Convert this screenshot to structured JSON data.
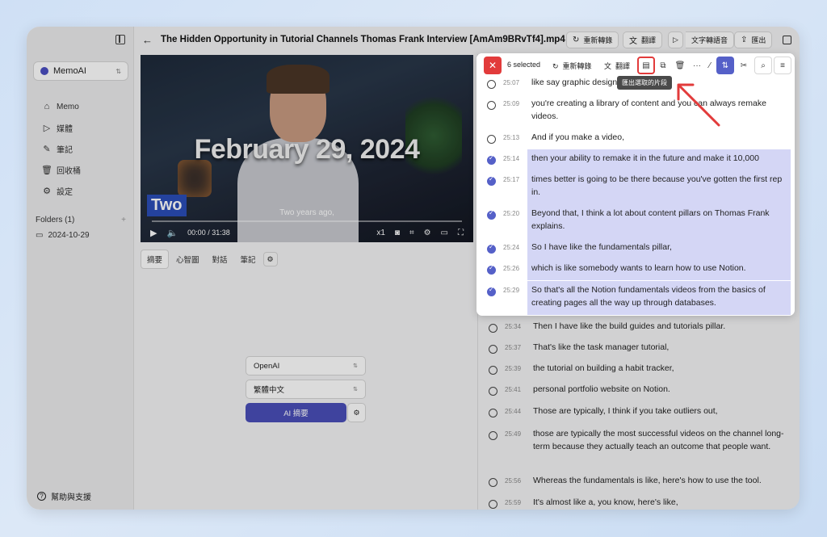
{
  "sidebar": {
    "workspace": "MemoAI",
    "nav": [
      {
        "icon": "home-icon",
        "glyph": "⌂",
        "label": "Memo"
      },
      {
        "icon": "media-icon",
        "glyph": "▷",
        "label": "媒體"
      },
      {
        "icon": "pen-icon",
        "glyph": "✎",
        "label": "筆記"
      },
      {
        "icon": "trash-icon",
        "glyph": "🗑",
        "label": "回收桶"
      },
      {
        "icon": "gear-icon",
        "glyph": "⚙",
        "label": "設定"
      }
    ],
    "folders_title": "Folders (1)",
    "folder_add": "+",
    "folders": [
      "2024-10-29"
    ],
    "help": "幫助與支援"
  },
  "topbar": {
    "title": "The Hidden Opportunity in Tutorial Channels Thomas Frank Interview [AmAm9BRvTf4].mp4",
    "buttons": {
      "retranscribe": "重新轉錄",
      "translate": "翻譯",
      "tts": "文字轉語音",
      "export": "匯出"
    }
  },
  "video": {
    "headline": "February 29, 2024",
    "tag": "Two",
    "caption": "Two years ago,",
    "time": "00:00 / 31:38",
    "speed": "x1",
    "progress": 0.0
  },
  "tabs": [
    "摘要",
    "心智圖",
    "對話",
    "筆記"
  ],
  "summary": {
    "model": "OpenAI",
    "language": "繁體中文",
    "button": "AI 摘要"
  },
  "selection": {
    "count": "6 selected",
    "retranscribe": "重新轉錄",
    "translate": "翻譯",
    "tooltip": "匯出選取的片段",
    "more": "···"
  },
  "transcript": [
    {
      "time": "25:07",
      "text": "like say graphic design or",
      "selected": false
    },
    {
      "time": "25:09",
      "text": "you're creating a library of content and you can always remake videos.",
      "selected": false
    },
    {
      "time": "25:13",
      "text": "And if you make a video,",
      "selected": false
    },
    {
      "time": "25:14",
      "text": "then your ability to remake it in the future and make it 10,000",
      "selected": true
    },
    {
      "time": "25:17",
      "text": "times better is going to be there because you've gotten the first rep in.",
      "selected": true
    },
    {
      "time": "25:20",
      "text": "Beyond that, I think a lot about content pillars on Thomas Frank explains.",
      "selected": true
    },
    {
      "time": "25:24",
      "text": "So I have like the fundamentals pillar,",
      "selected": true
    },
    {
      "time": "25:26",
      "text": "which is like somebody wants to learn how to use Notion.",
      "selected": true
    },
    {
      "time": "25:29",
      "text": "So that's all the Notion fundamentals videos from the basics of creating pages all the way up through databases.",
      "selected": true
    },
    {
      "time": "25:34",
      "text": "Then I have like the build guides and tutorials pillar.",
      "selected": false
    },
    {
      "time": "25:37",
      "text": "That's like the task manager tutorial,",
      "selected": false
    },
    {
      "time": "25:39",
      "text": "the tutorial on building a habit tracker,",
      "selected": false
    },
    {
      "time": "25:41",
      "text": "personal portfolio website on Notion.",
      "selected": false
    },
    {
      "time": "25:44",
      "text": "Those are typically, I think if you take outliers out,",
      "selected": false
    },
    {
      "time": "25:49",
      "text": "those are typically the most successful videos on the channel long-term because they actually teach an outcome that people want.",
      "selected": false
    },
    {
      "time": "25:56",
      "text": "Whereas the fundamentals is like, here's how to use the tool.",
      "selected": false
    },
    {
      "time": "25:59",
      "text": "It's almost like a, you know, here's like,",
      "selected": false
    }
  ],
  "colors": {
    "accent": "#5560c8",
    "highlight": "#d4d6f5",
    "danger": "#e23b3b",
    "primary_button": "#4a4fb9"
  }
}
